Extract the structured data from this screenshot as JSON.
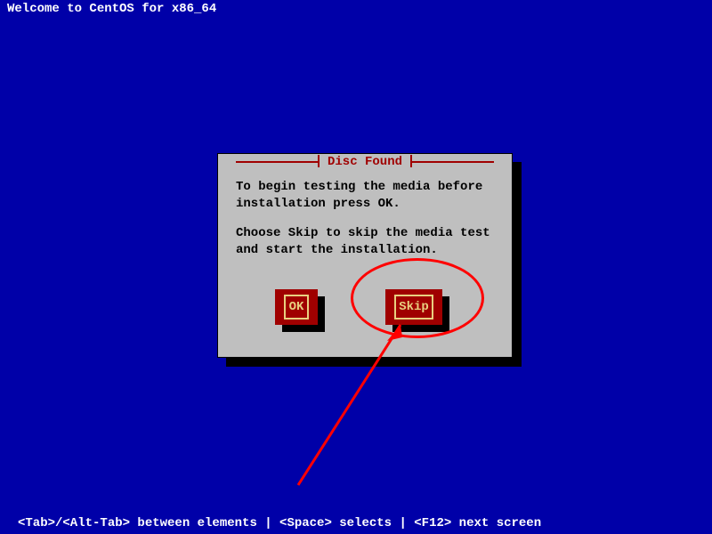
{
  "header": {
    "title": "Welcome to CentOS for x86_64"
  },
  "dialog": {
    "title": "Disc Found",
    "body_line1": "To begin testing the media before installation press OK.",
    "body_line2": "Choose Skip to skip the media test and start the installation.",
    "ok_label": "OK",
    "skip_label": "Skip"
  },
  "footer": {
    "text": "<Tab>/<Alt-Tab> between elements  | <Space> selects | <F12> next screen"
  }
}
